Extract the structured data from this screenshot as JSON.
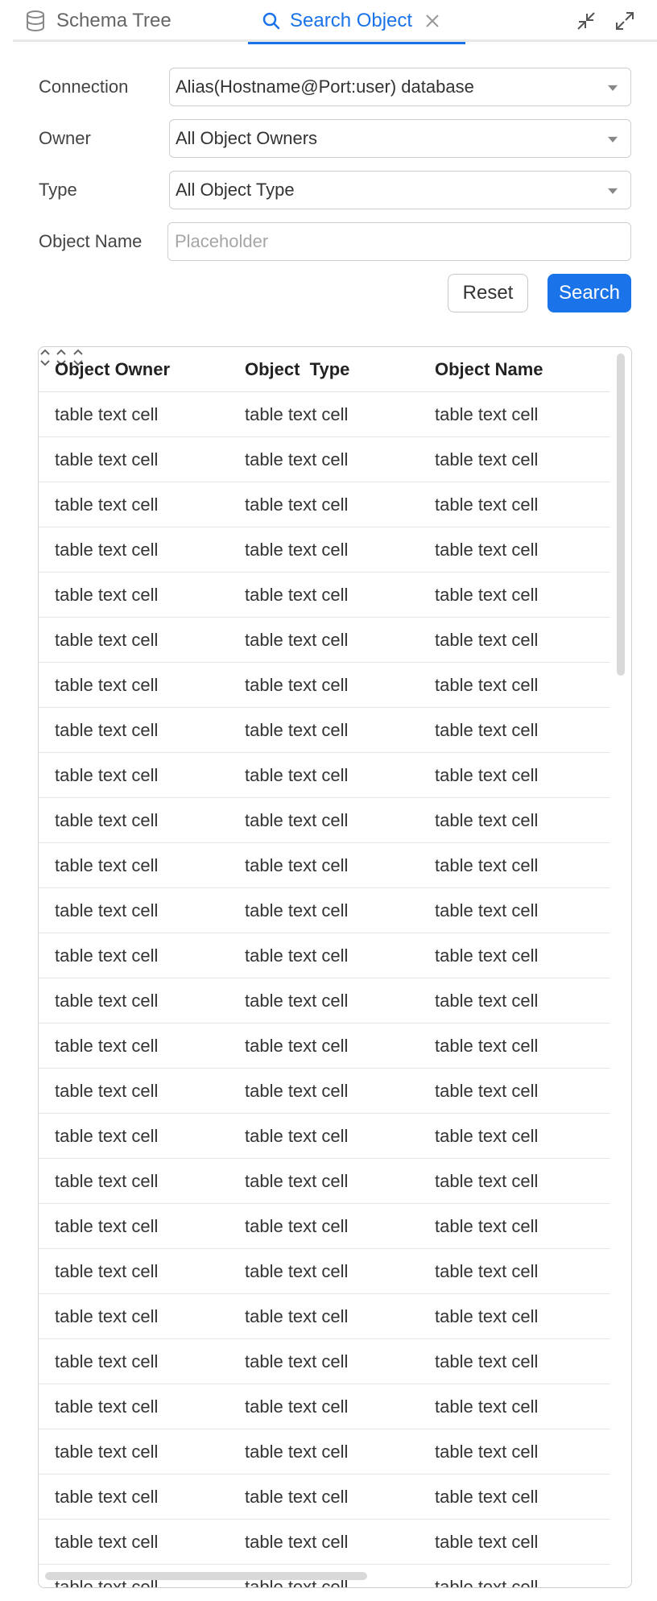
{
  "tabs": {
    "schema_tree": "Schema Tree",
    "search_object": "Search Object"
  },
  "form": {
    "connection_label": "Connection",
    "connection_value": "Alias(Hostname@Port:user) database",
    "owner_label": "Owner",
    "owner_value": "All Object Owners",
    "type_label": "Type",
    "type_value": "All Object Type",
    "object_name_label": "Object Name",
    "object_name_placeholder": "Placeholder"
  },
  "buttons": {
    "reset": "Reset",
    "search": "Search"
  },
  "table": {
    "columns": [
      "Object Owner",
      "Object  Type",
      "Object Name"
    ],
    "rows": [
      [
        "table text cell",
        "table text cell",
        "table text cell"
      ],
      [
        "table text cell",
        "table text cell",
        "table text cell"
      ],
      [
        "table text cell",
        "table text cell",
        "table text cell"
      ],
      [
        "table text cell",
        "table text cell",
        "table text cell"
      ],
      [
        "table text cell",
        "table text cell",
        "table text cell"
      ],
      [
        "table text cell",
        "table text cell",
        "table text cell"
      ],
      [
        "table text cell",
        "table text cell",
        "table text cell"
      ],
      [
        "table text cell",
        "table text cell",
        "table text cell"
      ],
      [
        "table text cell",
        "table text cell",
        "table text cell"
      ],
      [
        "table text cell",
        "table text cell",
        "table text cell"
      ],
      [
        "table text cell",
        "table text cell",
        "table text cell"
      ],
      [
        "table text cell",
        "table text cell",
        "table text cell"
      ],
      [
        "table text cell",
        "table text cell",
        "table text cell"
      ],
      [
        "table text cell",
        "table text cell",
        "table text cell"
      ],
      [
        "table text cell",
        "table text cell",
        "table text cell"
      ],
      [
        "table text cell",
        "table text cell",
        "table text cell"
      ],
      [
        "table text cell",
        "table text cell",
        "table text cell"
      ],
      [
        "table text cell",
        "table text cell",
        "table text cell"
      ],
      [
        "table text cell",
        "table text cell",
        "table text cell"
      ],
      [
        "table text cell",
        "table text cell",
        "table text cell"
      ],
      [
        "table text cell",
        "table text cell",
        "table text cell"
      ],
      [
        "table text cell",
        "table text cell",
        "table text cell"
      ],
      [
        "table text cell",
        "table text cell",
        "table text cell"
      ],
      [
        "table text cell",
        "table text cell",
        "table text cell"
      ],
      [
        "table text cell",
        "table text cell",
        "table text cell"
      ],
      [
        "table text cell",
        "table text cell",
        "table text cell"
      ],
      [
        "table text cell",
        "table text cell",
        "table text cell"
      ]
    ]
  },
  "icons": {
    "schema_tree": "database-icon",
    "search_tab": "search-icon",
    "close_tab": "close-icon",
    "collapse": "collapse-icon",
    "expand": "expand-icon",
    "sort": "sort-icon",
    "dropdown": "chevron-down-icon"
  },
  "colors": {
    "accent": "#1a73e8",
    "border": "#d0d0d0",
    "text": "#333333",
    "placeholder": "#a6a6a6"
  }
}
